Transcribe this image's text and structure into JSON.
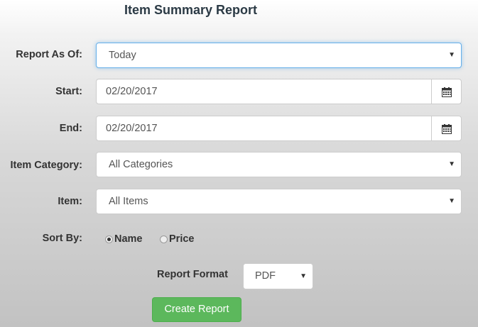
{
  "page": {
    "title": "Item Summary Report"
  },
  "form": {
    "report_as_of": {
      "label": "Report As Of:",
      "value": "Today"
    },
    "start": {
      "label": "Start:",
      "value": "02/20/2017"
    },
    "end": {
      "label": "End:",
      "value": "02/20/2017"
    },
    "item_category": {
      "label": "Item Category:",
      "value": "All Categories"
    },
    "item": {
      "label": "Item:",
      "value": "All Items"
    },
    "sort_by": {
      "label": "Sort By:",
      "options": [
        "Name",
        "Price"
      ],
      "selected": "Name"
    },
    "report_format": {
      "label": "Report Format",
      "value": "PDF"
    },
    "create_button": {
      "label": "Create Report"
    }
  },
  "icons": {
    "dropdown": "chevron-down-icon",
    "calendar": "calendar-icon"
  },
  "colors": {
    "primary_button": "#5cb85c",
    "focus_border": "#66afe9",
    "title": "#2b3a45"
  }
}
